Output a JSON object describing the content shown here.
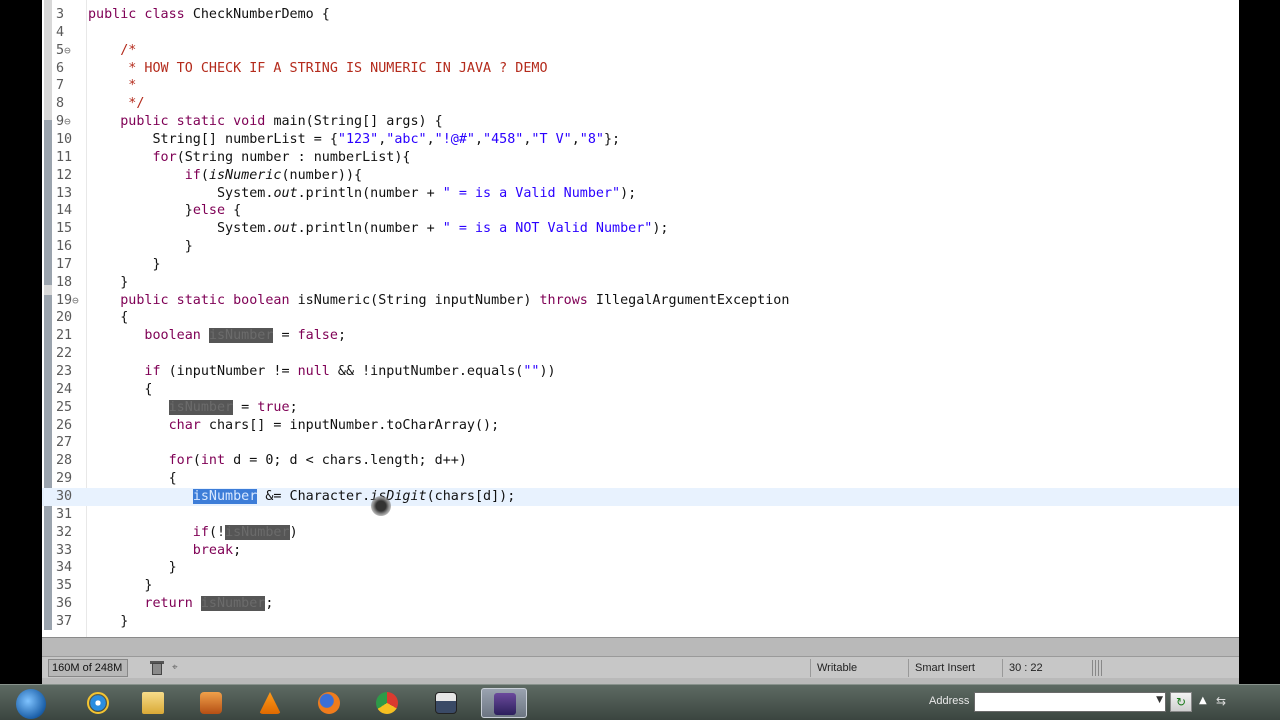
{
  "editor": {
    "lines": [
      {
        "n": "3",
        "fold": "",
        "parts": [
          {
            "t": "public class ",
            "c": "kw"
          },
          {
            "t": "CheckNumberDemo {",
            "c": ""
          }
        ]
      },
      {
        "n": "4",
        "fold": "",
        "parts": []
      },
      {
        "n": "5",
        "fold": "⊖",
        "parts": [
          {
            "t": "    /*",
            "c": "cmt"
          }
        ]
      },
      {
        "n": "6",
        "fold": "",
        "parts": [
          {
            "t": "     * HOW TO CHECK IF A STRING IS NUMERIC IN JAVA ? DEMO",
            "c": "cmt"
          }
        ]
      },
      {
        "n": "7",
        "fold": "",
        "parts": [
          {
            "t": "     *",
            "c": "cmt"
          }
        ]
      },
      {
        "n": "8",
        "fold": "",
        "parts": [
          {
            "t": "     */",
            "c": "cmt"
          }
        ]
      },
      {
        "n": "9",
        "fold": "⊖",
        "parts": [
          {
            "t": "    public static void ",
            "c": "kw"
          },
          {
            "t": "main(String[] args) {",
            "c": ""
          }
        ]
      },
      {
        "n": "10",
        "fold": "",
        "parts": [
          {
            "t": "        String[] numberList = {",
            "c": ""
          },
          {
            "t": "\"123\"",
            "c": "str"
          },
          {
            "t": ",",
            "c": ""
          },
          {
            "t": "\"abc\"",
            "c": "str"
          },
          {
            "t": ",",
            "c": ""
          },
          {
            "t": "\"!@#\"",
            "c": "str"
          },
          {
            "t": ",",
            "c": ""
          },
          {
            "t": "\"458\"",
            "c": "str"
          },
          {
            "t": ",",
            "c": ""
          },
          {
            "t": "\"T V\"",
            "c": "str"
          },
          {
            "t": ",",
            "c": ""
          },
          {
            "t": "\"8\"",
            "c": "str"
          },
          {
            "t": "};",
            "c": ""
          }
        ]
      },
      {
        "n": "11",
        "fold": "",
        "parts": [
          {
            "t": "        for",
            "c": "kw"
          },
          {
            "t": "(String number : numberList){",
            "c": ""
          }
        ]
      },
      {
        "n": "12",
        "fold": "",
        "parts": [
          {
            "t": "            if",
            "c": "kw"
          },
          {
            "t": "(",
            "c": ""
          },
          {
            "t": "isNumeric",
            "c": "ital"
          },
          {
            "t": "(number)){",
            "c": ""
          }
        ]
      },
      {
        "n": "13",
        "fold": "",
        "parts": [
          {
            "t": "                System.",
            "c": ""
          },
          {
            "t": "out",
            "c": "ital"
          },
          {
            "t": ".println(number + ",
            "c": ""
          },
          {
            "t": "\" = is a Valid Number\"",
            "c": "str"
          },
          {
            "t": ");",
            "c": ""
          }
        ]
      },
      {
        "n": "14",
        "fold": "",
        "parts": [
          {
            "t": "            }",
            "c": ""
          },
          {
            "t": "else",
            "c": "kw"
          },
          {
            "t": " {",
            "c": ""
          }
        ]
      },
      {
        "n": "15",
        "fold": "",
        "parts": [
          {
            "t": "                System.",
            "c": ""
          },
          {
            "t": "out",
            "c": "ital"
          },
          {
            "t": ".println(number + ",
            "c": ""
          },
          {
            "t": "\" = is a NOT Valid Number\"",
            "c": "str"
          },
          {
            "t": ");",
            "c": ""
          }
        ]
      },
      {
        "n": "16",
        "fold": "",
        "parts": [
          {
            "t": "            }",
            "c": ""
          }
        ]
      },
      {
        "n": "17",
        "fold": "",
        "parts": [
          {
            "t": "        }",
            "c": ""
          }
        ]
      },
      {
        "n": "18",
        "fold": "",
        "parts": [
          {
            "t": "    }",
            "c": ""
          }
        ]
      },
      {
        "n": "19",
        "fold": "⊖",
        "parts": [
          {
            "t": "    public static boolean ",
            "c": "kw"
          },
          {
            "t": "isNumeric(String inputNumber) ",
            "c": ""
          },
          {
            "t": "throws",
            "c": "kw"
          },
          {
            "t": " IllegalArgumentException",
            "c": ""
          }
        ]
      },
      {
        "n": "20",
        "fold": "",
        "parts": [
          {
            "t": "    {",
            "c": ""
          }
        ]
      },
      {
        "n": "21",
        "fold": "",
        "parts": [
          {
            "t": "       boolean ",
            "c": "kw"
          },
          {
            "t": "isNumber",
            "c": "occ"
          },
          {
            "t": " = ",
            "c": ""
          },
          {
            "t": "false",
            "c": "kw"
          },
          {
            "t": ";",
            "c": ""
          }
        ]
      },
      {
        "n": "22",
        "fold": "",
        "parts": []
      },
      {
        "n": "23",
        "fold": "",
        "parts": [
          {
            "t": "       if",
            "c": "kw"
          },
          {
            "t": " (inputNumber != ",
            "c": ""
          },
          {
            "t": "null",
            "c": "kw"
          },
          {
            "t": " && !inputNumber.equals(",
            "c": ""
          },
          {
            "t": "\"\"",
            "c": "str"
          },
          {
            "t": "))",
            "c": ""
          }
        ]
      },
      {
        "n": "24",
        "fold": "",
        "parts": [
          {
            "t": "       {",
            "c": ""
          }
        ]
      },
      {
        "n": "25",
        "fold": "",
        "parts": [
          {
            "t": "          ",
            "c": ""
          },
          {
            "t": "isNumber",
            "c": "occ"
          },
          {
            "t": " = ",
            "c": ""
          },
          {
            "t": "true",
            "c": "kw"
          },
          {
            "t": ";",
            "c": ""
          }
        ]
      },
      {
        "n": "26",
        "fold": "",
        "parts": [
          {
            "t": "          char",
            "c": "kw"
          },
          {
            "t": " chars[] = inputNumber.toCharArray();",
            "c": ""
          }
        ]
      },
      {
        "n": "27",
        "fold": "",
        "parts": []
      },
      {
        "n": "28",
        "fold": "",
        "parts": [
          {
            "t": "          for",
            "c": "kw"
          },
          {
            "t": "(",
            "c": ""
          },
          {
            "t": "int",
            "c": "kw"
          },
          {
            "t": " d = 0; d < chars.length; d++)",
            "c": ""
          }
        ]
      },
      {
        "n": "29",
        "fold": "",
        "parts": [
          {
            "t": "          {",
            "c": ""
          }
        ]
      },
      {
        "n": "30",
        "fold": "",
        "current": true,
        "parts": [
          {
            "t": "             ",
            "c": ""
          },
          {
            "t": "isNumber",
            "c": "sel"
          },
          {
            "t": " &= Character.",
            "c": ""
          },
          {
            "t": "isDigit",
            "c": "ital"
          },
          {
            "t": "(chars[d]);",
            "c": ""
          }
        ]
      },
      {
        "n": "31",
        "fold": "",
        "parts": []
      },
      {
        "n": "32",
        "fold": "",
        "parts": [
          {
            "t": "             if",
            "c": "kw"
          },
          {
            "t": "(!",
            "c": ""
          },
          {
            "t": "isNumber",
            "c": "occ"
          },
          {
            "t": ")",
            "c": ""
          }
        ]
      },
      {
        "n": "33",
        "fold": "",
        "parts": [
          {
            "t": "             break",
            "c": "kw"
          },
          {
            "t": ";",
            "c": ""
          }
        ]
      },
      {
        "n": "34",
        "fold": "",
        "parts": [
          {
            "t": "          }",
            "c": ""
          }
        ]
      },
      {
        "n": "35",
        "fold": "",
        "parts": [
          {
            "t": "       }",
            "c": ""
          }
        ]
      },
      {
        "n": "36",
        "fold": "",
        "parts": [
          {
            "t": "       return ",
            "c": "kw"
          },
          {
            "t": "isNumber",
            "c": "occ"
          },
          {
            "t": ";",
            "c": ""
          }
        ]
      },
      {
        "n": "37",
        "fold": "",
        "parts": [
          {
            "t": "    }",
            "c": ""
          }
        ]
      }
    ]
  },
  "status": {
    "heap": "160M of 248M",
    "writable": "Writable",
    "insert_mode": "Smart Insert",
    "position": "30 : 22"
  },
  "taskbar": {
    "address_label": "Address",
    "address_value": "",
    "apps": [
      "ie-icon",
      "explorer-icon",
      "media-player-icon",
      "vlc-icon",
      "firefox-icon",
      "chrome-icon",
      "save-icon",
      "eclipse-icon"
    ]
  }
}
